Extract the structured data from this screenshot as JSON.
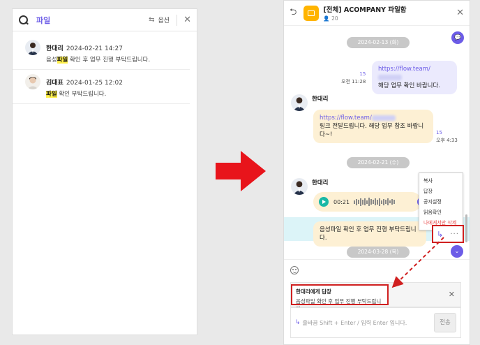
{
  "search": {
    "query": "파일",
    "options_label": "옵션",
    "results": [
      {
        "name": "한대리",
        "date": "2024-02-21 14:27",
        "pre": "음성",
        "highlight": "파일",
        "post": " 확인 후 업무 진행 부탁드립니다."
      },
      {
        "name": "김대표",
        "date": "2024-01-25 12:02",
        "pre": "",
        "highlight": "파일",
        "post": " 확인 부탁드립니다."
      }
    ]
  },
  "chat": {
    "room_title": "[전체] ACOMPANY 파일함",
    "member_count": "20",
    "date1": "2024-02-13 (화)",
    "msg1_link": "https://flow.team/",
    "msg1_text": "해당 업무 확인 바랍니다.",
    "msg1_unread": "15",
    "msg1_time": "오전 11:28",
    "sender1": "한대리",
    "msg2_link": "https://flow.team/",
    "msg2_text": "링크 전달드립니다. 해당 업무 참조 바랍니다~!",
    "msg2_unread": "15",
    "msg2_time": "오후 4:33",
    "date2": "2024-02-21 (수)",
    "sender2": "한대리",
    "voice_time": "00:21",
    "voice_badge": "1",
    "msg3_text": "음성파일 확인 후 업무 진행 부탁드립니다.",
    "date3": "2024-03-28 (목)",
    "menu": [
      "복사",
      "답장",
      "공지설정",
      "읽음확인",
      "나에게서만 삭제"
    ]
  },
  "composer": {
    "reply_title": "한대리에게 답장",
    "reply_text": "음성파일 확인 후 업무 진행 부탁드립니다.",
    "placeholder": "줄바꿈 Shift + Enter / 입력 Enter 입니다.",
    "send_label": "전송"
  },
  "colors": {
    "accent": "#6c5ce7",
    "highlight": "#fff04a",
    "alert": "#d02020"
  }
}
